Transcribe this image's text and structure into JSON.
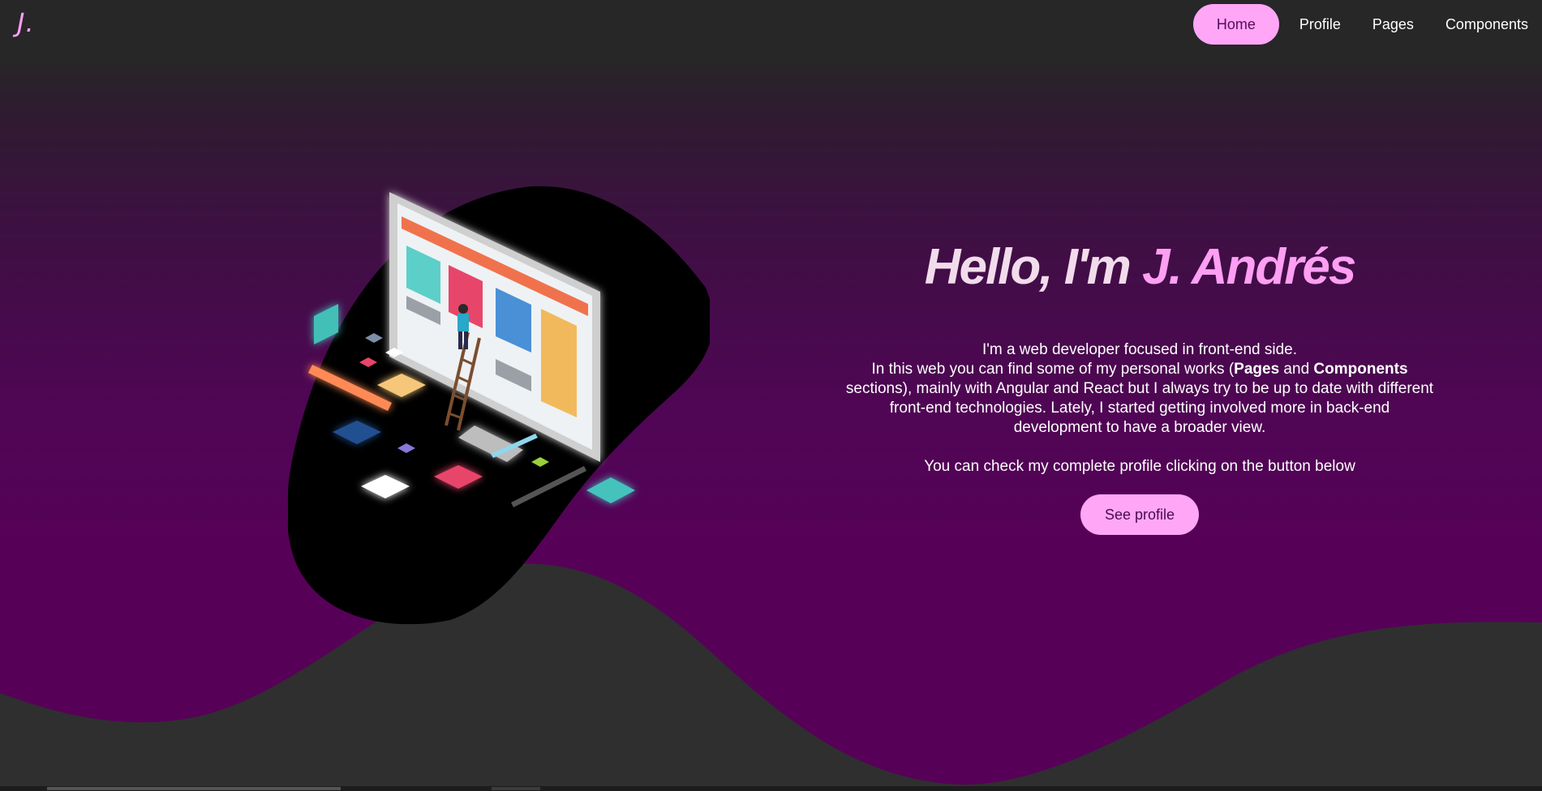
{
  "brand": {
    "logo": "J.",
    "accent": "#ff9ff3",
    "button_color": "#ffa6f7",
    "bg_top": "#272727",
    "bg_bottom": "#570058"
  },
  "nav": {
    "items": [
      {
        "label": "Home",
        "active": true
      },
      {
        "label": "Profile",
        "active": false
      },
      {
        "label": "Pages",
        "active": false
      },
      {
        "label": "Components",
        "active": false
      }
    ]
  },
  "hero": {
    "title_intro": "Hello, I'm",
    "title_name": "J. Andrés",
    "line1": "I'm a web developer focused in front-end side.",
    "line2_a": "In this web you can find some of my personal works (",
    "line2_pages": "Pages",
    "line2_and": " and ",
    "line2_components": "Components",
    "line2_b": " sections), mainly with Angular and React but I always try to be up to date with different front-end technologies. Lately, I started getting involved more in back-end development to have a broader view.",
    "line3": "You can check my complete profile clicking on the button below",
    "cta_label": "See profile",
    "illustration": "isometric-web-developer-illustration"
  }
}
